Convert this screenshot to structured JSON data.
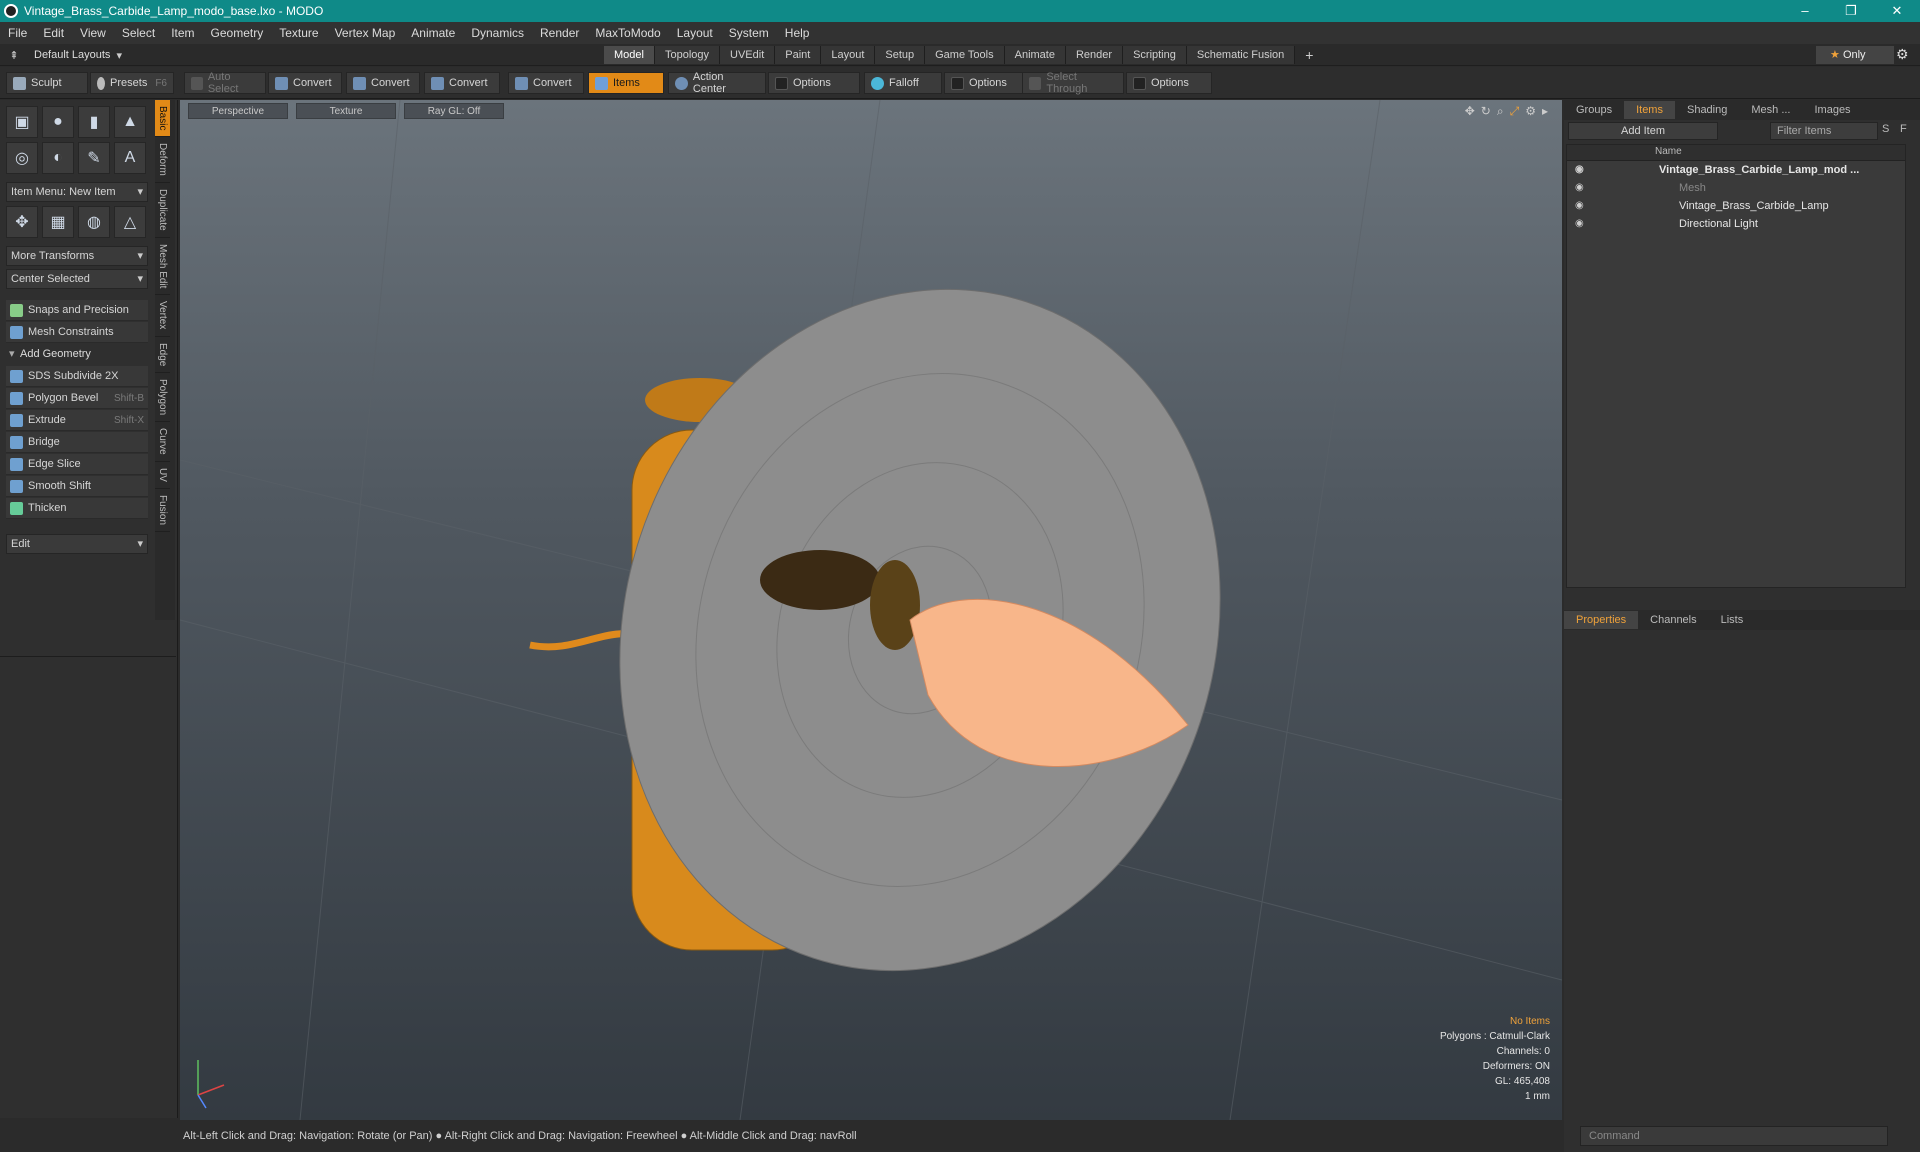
{
  "window": {
    "title": "Vintage_Brass_Carbide_Lamp_modo_base.lxo - MODO",
    "controls": [
      "–",
      "❐",
      "✕"
    ]
  },
  "menu": [
    "File",
    "Edit",
    "View",
    "Select",
    "Item",
    "Geometry",
    "Texture",
    "Vertex Map",
    "Animate",
    "Dynamics",
    "Render",
    "MaxToModo",
    "Layout",
    "System",
    "Help"
  ],
  "layout": {
    "default_layouts": "Default Layouts",
    "tabs": [
      "Model",
      "Topology",
      "UVEdit",
      "Paint",
      "Layout",
      "Setup",
      "Game Tools",
      "Animate",
      "Render",
      "Scripting",
      "Schematic Fusion"
    ],
    "active_tab": "Model",
    "plus": "+",
    "only": "Only"
  },
  "toolbar": {
    "sculpt": "Sculpt",
    "presets": "Presets",
    "presets_key": "F6",
    "auto_select": "Auto Select",
    "convert1": "Convert",
    "convert2": "Convert",
    "convert3": "Convert",
    "convert4": "Convert",
    "items": "Items",
    "action_center": "Action Center",
    "options1": "Options",
    "falloff": "Falloff",
    "options2": "Options",
    "select_through": "Select Through",
    "options3": "Options"
  },
  "left": {
    "vtabs": [
      "Basic",
      "Deform",
      "Duplicate",
      "Mesh Edit",
      "Vertex",
      "Edge",
      "Polygon",
      "Curve",
      "UV",
      "Fusion"
    ],
    "item_menu": "Item Menu: New Item",
    "more_transforms": "More Transforms",
    "center_selected": "Center Selected",
    "snaps": "Snaps and Precision",
    "constraints": "Mesh Constraints",
    "add_geometry": "Add Geometry",
    "tools": [
      {
        "label": "SDS Subdivide 2X",
        "shortcut": ""
      },
      {
        "label": "Polygon Bevel",
        "shortcut": "Shift-B"
      },
      {
        "label": "Extrude",
        "shortcut": "Shift-X"
      },
      {
        "label": "Bridge",
        "shortcut": ""
      },
      {
        "label": "Edge Slice",
        "shortcut": ""
      },
      {
        "label": "Smooth Shift",
        "shortcut": ""
      },
      {
        "label": "Thicken",
        "shortcut": ""
      }
    ],
    "edit": "Edit"
  },
  "viewport": {
    "view": "Perspective",
    "shading": "Texture",
    "raygl": "Ray GL: Off",
    "stats": {
      "selection": "No Items",
      "polygons": "Polygons : Catmull-Clark",
      "channels": "Channels: 0",
      "deformers": "Deformers: ON",
      "gl": "GL: 465,408",
      "unit": "1 mm"
    }
  },
  "status": "Alt-Left Click and Drag: Navigation: Rotate (or Pan) ● Alt-Right Click and Drag: Navigation: Freewheel ● Alt-Middle Click and Drag: navRoll",
  "right": {
    "tabs": [
      "Groups",
      "Items",
      "Shading",
      "Mesh ...",
      "Images"
    ],
    "active_tab": "Items",
    "add_item": "Add Item",
    "filter": "Filter Items",
    "s": "S",
    "f": "F",
    "name_col": "Name",
    "items": [
      {
        "label": "Vintage_Brass_Carbide_Lamp_mod ...",
        "indent": 0
      },
      {
        "label": "Mesh",
        "indent": 1
      },
      {
        "label": "Vintage_Brass_Carbide_Lamp",
        "indent": 1
      },
      {
        "label": "Directional Light",
        "indent": 1
      }
    ],
    "prop_tabs": [
      "Properties",
      "Channels",
      "Lists"
    ],
    "active_prop_tab": "Properties",
    "command_placeholder": "Command"
  },
  "colors": {
    "accent": "#e28a17",
    "titlebar": "#0f8a88",
    "viewport_top": "#6b747c"
  }
}
